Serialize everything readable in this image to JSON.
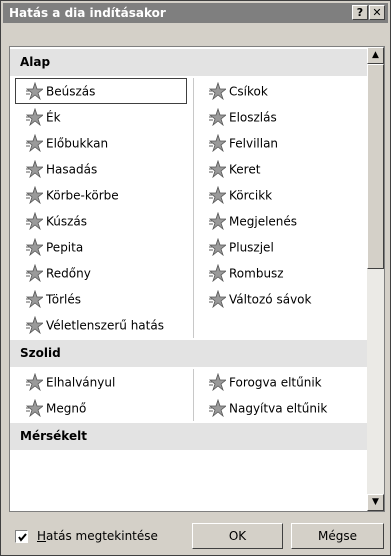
{
  "window": {
    "title": "Hatás a dia indításakor",
    "help_btn": "?",
    "close_btn": "✕"
  },
  "categories": [
    {
      "label": "Alap",
      "items": [
        {
          "label": "Beúszás",
          "icon": "fly-in-icon",
          "selected": true
        },
        {
          "label": "Csíkok",
          "icon": "blinds-icon"
        },
        {
          "label": "Ék",
          "icon": "wedge-icon"
        },
        {
          "label": "Eloszlás",
          "icon": "dissolve-icon"
        },
        {
          "label": "Előbukkan",
          "icon": "peek-icon"
        },
        {
          "label": "Felvillan",
          "icon": "flash-icon"
        },
        {
          "label": "Hasadás",
          "icon": "split-icon"
        },
        {
          "label": "Keret",
          "icon": "box-icon"
        },
        {
          "label": "Körbe-körbe",
          "icon": "circle-icon"
        },
        {
          "label": "Körcikk",
          "icon": "wheel-icon"
        },
        {
          "label": "Kúszás",
          "icon": "crawl-icon"
        },
        {
          "label": "Megjelenés",
          "icon": "appear-icon"
        },
        {
          "label": "Pepita",
          "icon": "checkerboard-icon"
        },
        {
          "label": "Pluszjel",
          "icon": "plus-icon"
        },
        {
          "label": "Redőny",
          "icon": "shutter-icon"
        },
        {
          "label": "Rombusz",
          "icon": "diamond-icon"
        },
        {
          "label": "Törlés",
          "icon": "wipe-icon"
        },
        {
          "label": "Változó sávok",
          "icon": "strips-icon"
        },
        {
          "label": "Véletlenszerű hatás",
          "icon": "random-icon"
        }
      ]
    },
    {
      "label": "Szolid",
      "items": [
        {
          "label": "Elhalványul",
          "icon": "fade-icon"
        },
        {
          "label": "Forogva eltűnik",
          "icon": "spin-out-icon"
        },
        {
          "label": "Megnő",
          "icon": "grow-icon"
        },
        {
          "label": "Nagyítva eltűnik",
          "icon": "zoom-out-icon"
        }
      ]
    },
    {
      "label": "Mérsékelt",
      "items": []
    }
  ],
  "footer": {
    "preview_checkbox": {
      "label_underlined": "H",
      "label_rest": "atás megtekintése",
      "checked": true
    },
    "ok_label": "OK",
    "cancel_label": "Mégse"
  }
}
